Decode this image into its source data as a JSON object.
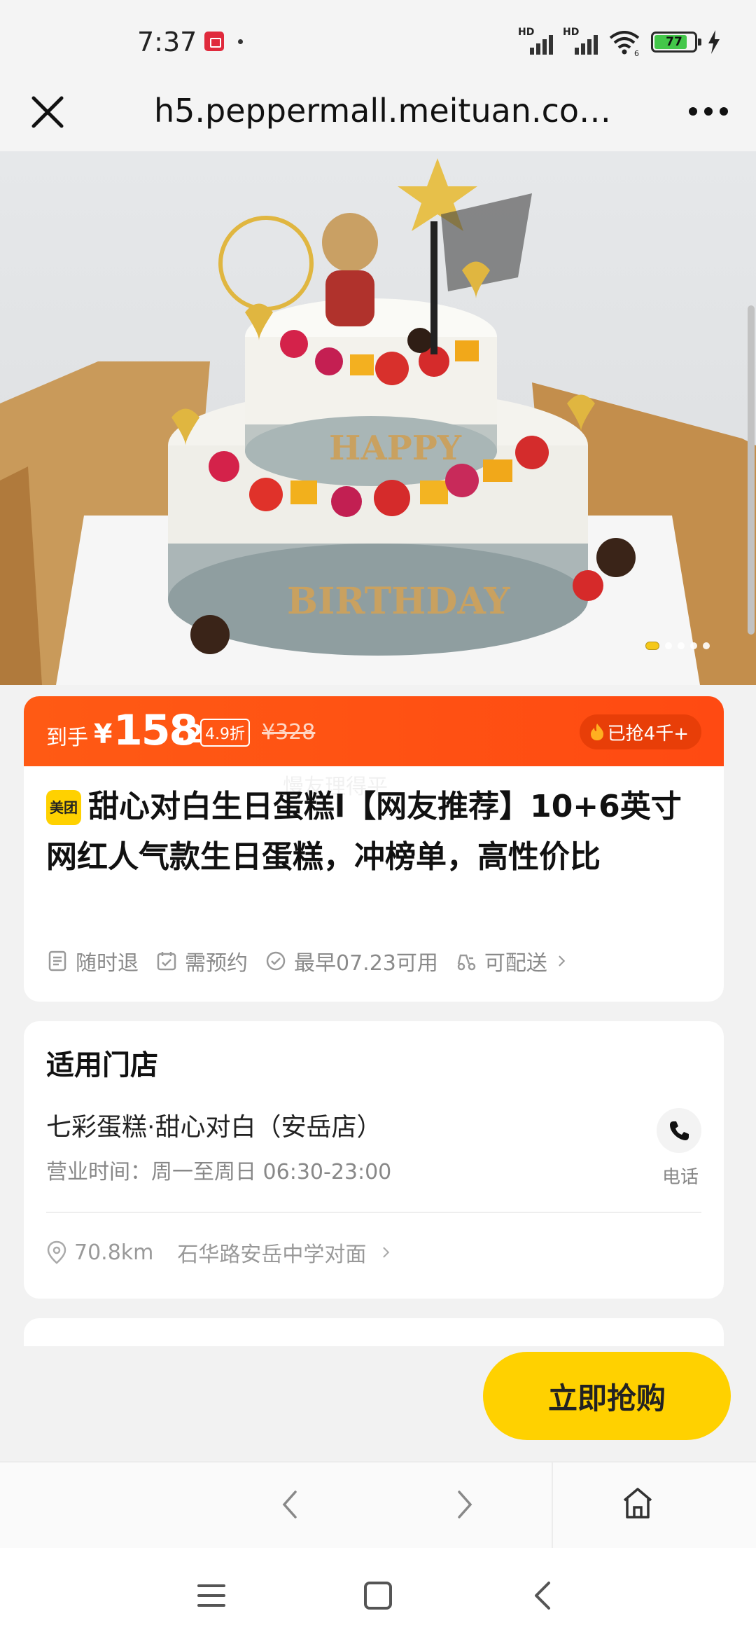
{
  "status_bar": {
    "time": "7:37",
    "signal1_label": "HD",
    "signal2_label": "HD",
    "battery_level": "77"
  },
  "nav": {
    "url": "h5.peppermall.meituan.co…"
  },
  "hero": {
    "total_images": 5,
    "current_image": 1,
    "cake_lettering": [
      "HAPPY",
      "BIRTHDAY"
    ]
  },
  "product": {
    "price_label": "到手",
    "currency": "¥",
    "price_int": "158",
    "price_dec": ".2",
    "discount": "4.9折",
    "original_price": "¥328",
    "sold": "已抢4千+",
    "brand_badge": "美团",
    "title": "甜心对白生日蛋糕l【网友推荐】10+6英寸网红人气款生日蛋糕，冲榜单，高性价比",
    "tags": [
      "随时退",
      "需预约",
      "最早07.23可用",
      "可配送"
    ],
    "watermark": "慢友理得平"
  },
  "store": {
    "section_title": "适用门店",
    "name": "七彩蛋糕·甜心对白（安岳店）",
    "hours": "营业时间：周一至周日 06:30-23:00",
    "phone_label": "电话",
    "distance": "70.8km",
    "address": "石华路安岳中学对面"
  },
  "cta": {
    "buy_label": "立即抢购"
  },
  "colors": {
    "price_bar": "#ff4a12",
    "buy_button": "#ffd100",
    "brand": "#ffd100"
  }
}
